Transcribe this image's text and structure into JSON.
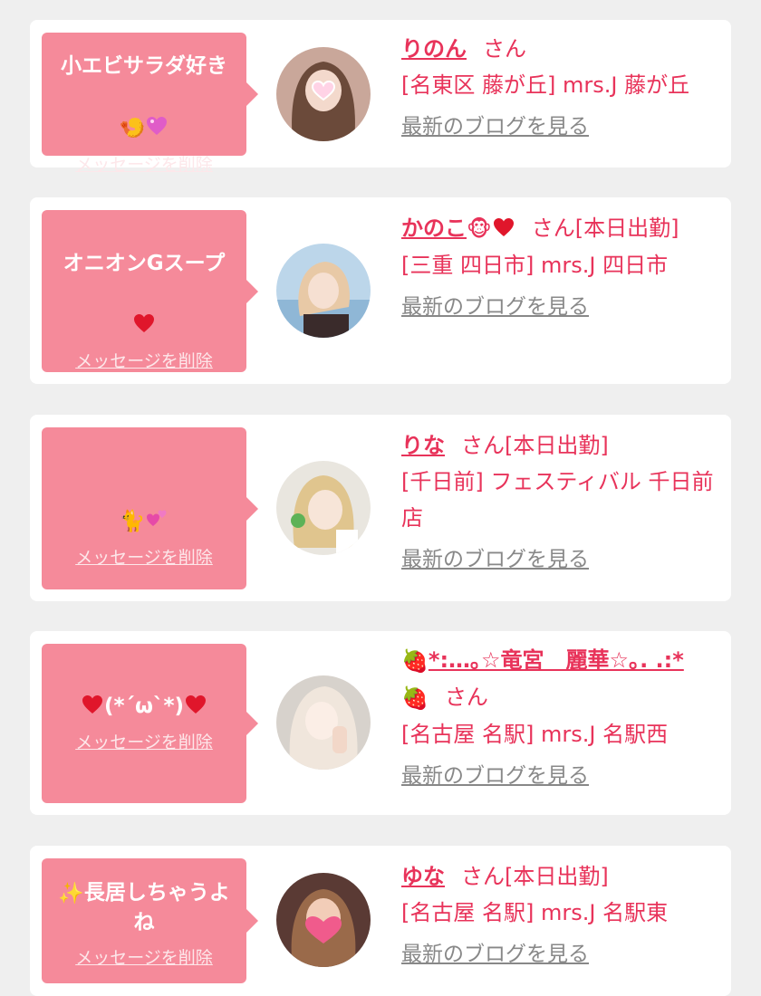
{
  "delete_label": "メッセージを削除",
  "blog_label": "最新のブログを見る",
  "honorific": "さん",
  "colors": {
    "bubble": "#f58a9a",
    "accent": "#e8335a",
    "link_gray": "#888888",
    "card": "#ffffff",
    "page_bg": "#efefef"
  },
  "items": [
    {
      "message": "小エビサラダ好き",
      "message_icons": [
        "shrimp-icon",
        "sparkling-heart-icon"
      ],
      "name": "りのん",
      "name_icons": [],
      "status": "",
      "shop": "[名東区 藤が丘] mrs.J 藤が丘"
    },
    {
      "message": "オニオンGスープ",
      "message_icons": [
        "red-heart-icon"
      ],
      "name": "かのこ",
      "name_icons": [
        "monkey-face-icon",
        "red-heart-icon"
      ],
      "status": "[本日出勤]",
      "shop": "[三重 四日市] mrs.J 四日市"
    },
    {
      "message": "",
      "message_icons": [
        "black-cat-icon",
        "two-hearts-icon"
      ],
      "name": "りな",
      "name_icons": [],
      "status": "[本日出勤]",
      "shop": "[千日前] フェスティバル 千日前店"
    },
    {
      "message": "(*´ω`*)",
      "message_icons": [
        "red-heart-icon",
        "red-heart-icon"
      ],
      "name": "*:…｡☆竜宮　麗華☆｡. .:*",
      "name_icons": [
        "strawberry-icon",
        "strawberry-icon"
      ],
      "status": "",
      "shop": "[名古屋 名駅] mrs.J 名駅西"
    },
    {
      "message": "長居しちゃうよね",
      "message_icons": [
        "sparkles-icon"
      ],
      "name": "ゆな",
      "name_icons": [],
      "status": "[本日出勤]",
      "shop": "[名古屋 名駅] mrs.J 名駅東"
    }
  ]
}
